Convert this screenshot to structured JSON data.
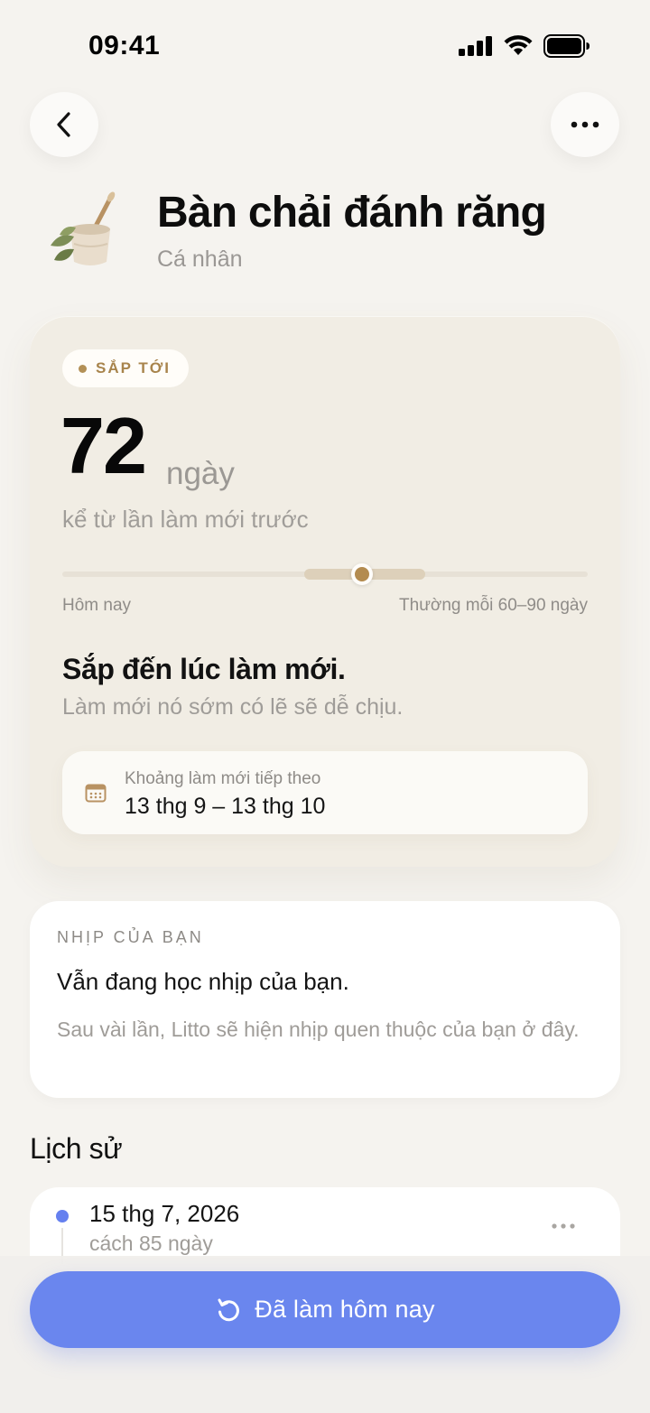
{
  "status_bar": {
    "time": "09:41"
  },
  "item": {
    "title": "Bàn chải đánh răng",
    "category": "Cá nhân",
    "image_icon": "toothbrush-cup-icon"
  },
  "status_card": {
    "badge": "SẮP TỚI",
    "days_value": "72",
    "days_unit": "ngày",
    "since_text": "kể từ lần làm mới trước",
    "progress_fraction": 0.57,
    "typical_range_fraction": [
      0.46,
      0.69
    ],
    "track_label_left": "Hôm nay",
    "track_label_right": "Thường mỗi 60–90 ngày",
    "message_title": "Sắp đến lúc làm mới.",
    "message_sub": "Làm mới nó sớm có lẽ sẽ dễ chịu.",
    "next_window_label": "Khoảng làm mới tiếp theo",
    "next_window_value": "13 thg 9 – 13 thg 10"
  },
  "rhythm": {
    "label": "NHỊP CỦA BẠN",
    "title": "Vẫn đang học nhịp của bạn.",
    "description": "Sau vài lần, Litto sẽ hiện nhịp quen thuộc của bạn ở đây."
  },
  "history": {
    "title": "Lịch sử",
    "entries": [
      {
        "date": "15 thg 7, 2026",
        "ago": "cách 85 ngày"
      }
    ]
  },
  "cta": {
    "label": "Đã làm hôm nay",
    "icon": "refresh-icon"
  },
  "colors": {
    "accent": "#6a86ee",
    "gold": "#b38b4f",
    "background": "#f5f3ef",
    "card_beige": "#f1ede4"
  }
}
